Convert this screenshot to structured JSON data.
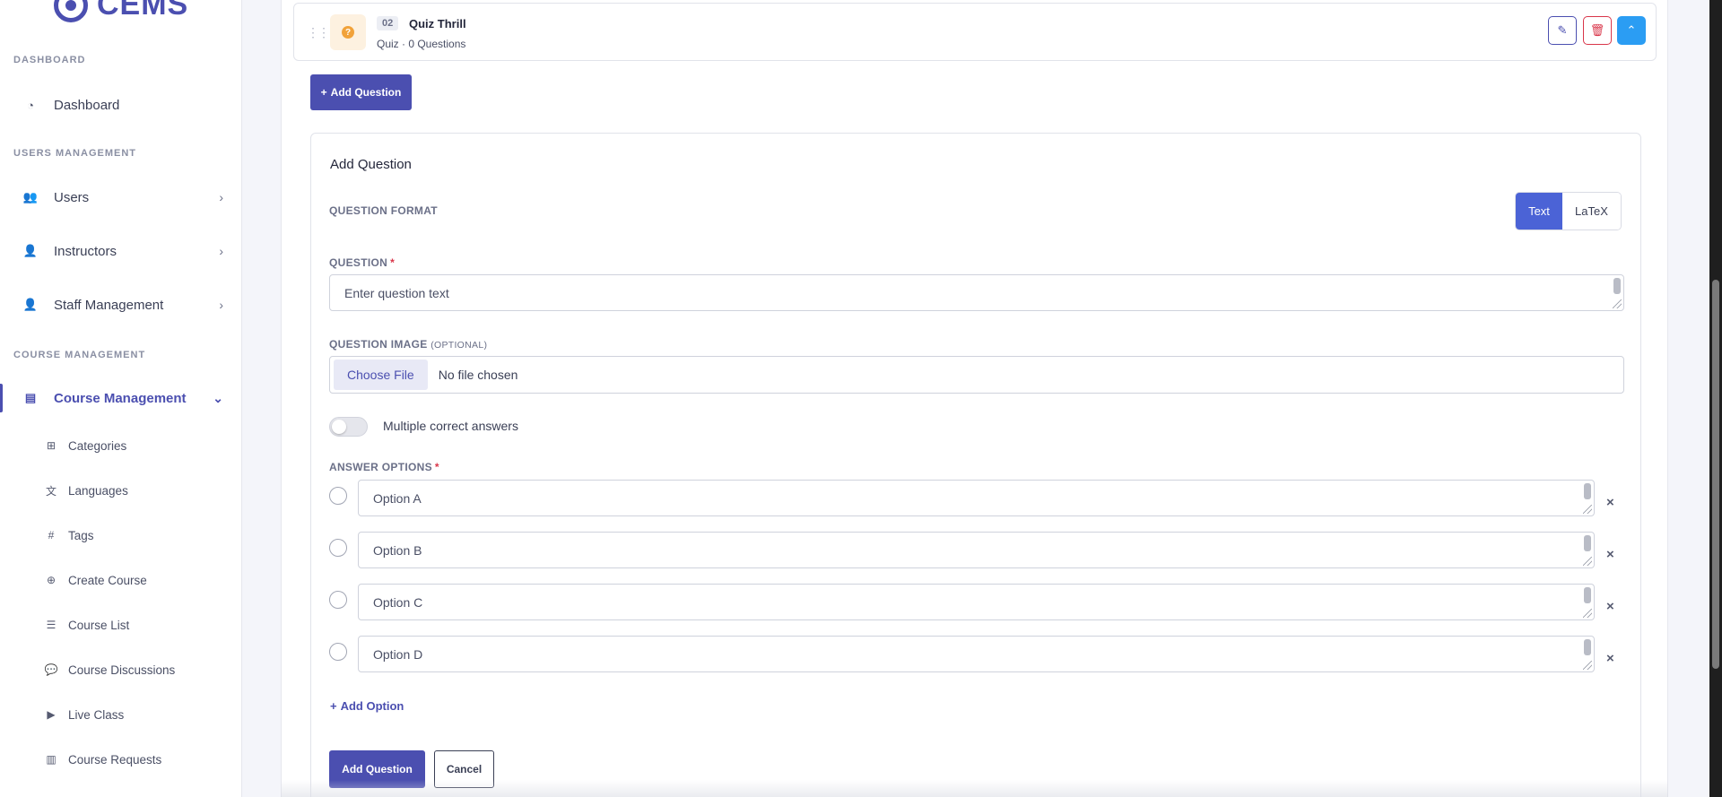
{
  "sidebar": {
    "brand": "CEMS",
    "sections": {
      "dashboard": "DASHBOARD",
      "users": "USERS MANAGEMENT",
      "course": "COURSE MANAGEMENT"
    },
    "items": {
      "dashboard": "Dashboard",
      "users": "Users",
      "instructors": "Instructors",
      "staff": "Staff Management",
      "course_management": "Course Management"
    },
    "sub_items": {
      "categories": "Categories",
      "languages": "Languages",
      "tags": "Tags",
      "create_course": "Create Course",
      "course_list": "Course List",
      "course_discussions": "Course Discussions",
      "live_class": "Live Class",
      "course_requests": "Course Requests"
    }
  },
  "lesson": {
    "number": "02",
    "title": "Quiz Thrill",
    "subtitle": "Quiz · 0 Questions"
  },
  "toolbar": {
    "add_question": "Add Question"
  },
  "form": {
    "title": "Add Question",
    "format_label": "QUESTION FORMAT",
    "format_options": [
      "Text",
      "LaTeX"
    ],
    "format_selected": "Text",
    "question_label": "QUESTION",
    "question_placeholder": "Enter question text",
    "image_label": "QUESTION IMAGE",
    "image_optional": "(OPTIONAL)",
    "choose_file": "Choose File",
    "no_file": "No file chosen",
    "multiple_label": "Multiple correct answers",
    "multiple_enabled": false,
    "answers_label": "ANSWER OPTIONS",
    "options": [
      "Option A",
      "Option B",
      "Option C",
      "Option D"
    ],
    "add_option": "Add Option",
    "submit": "Add Question",
    "cancel": "Cancel"
  },
  "colors": {
    "primary": "#4b4fb0",
    "accent_blue": "#2b9df3",
    "danger": "#d9364a",
    "toggle_text_active": "#4b63d6"
  }
}
